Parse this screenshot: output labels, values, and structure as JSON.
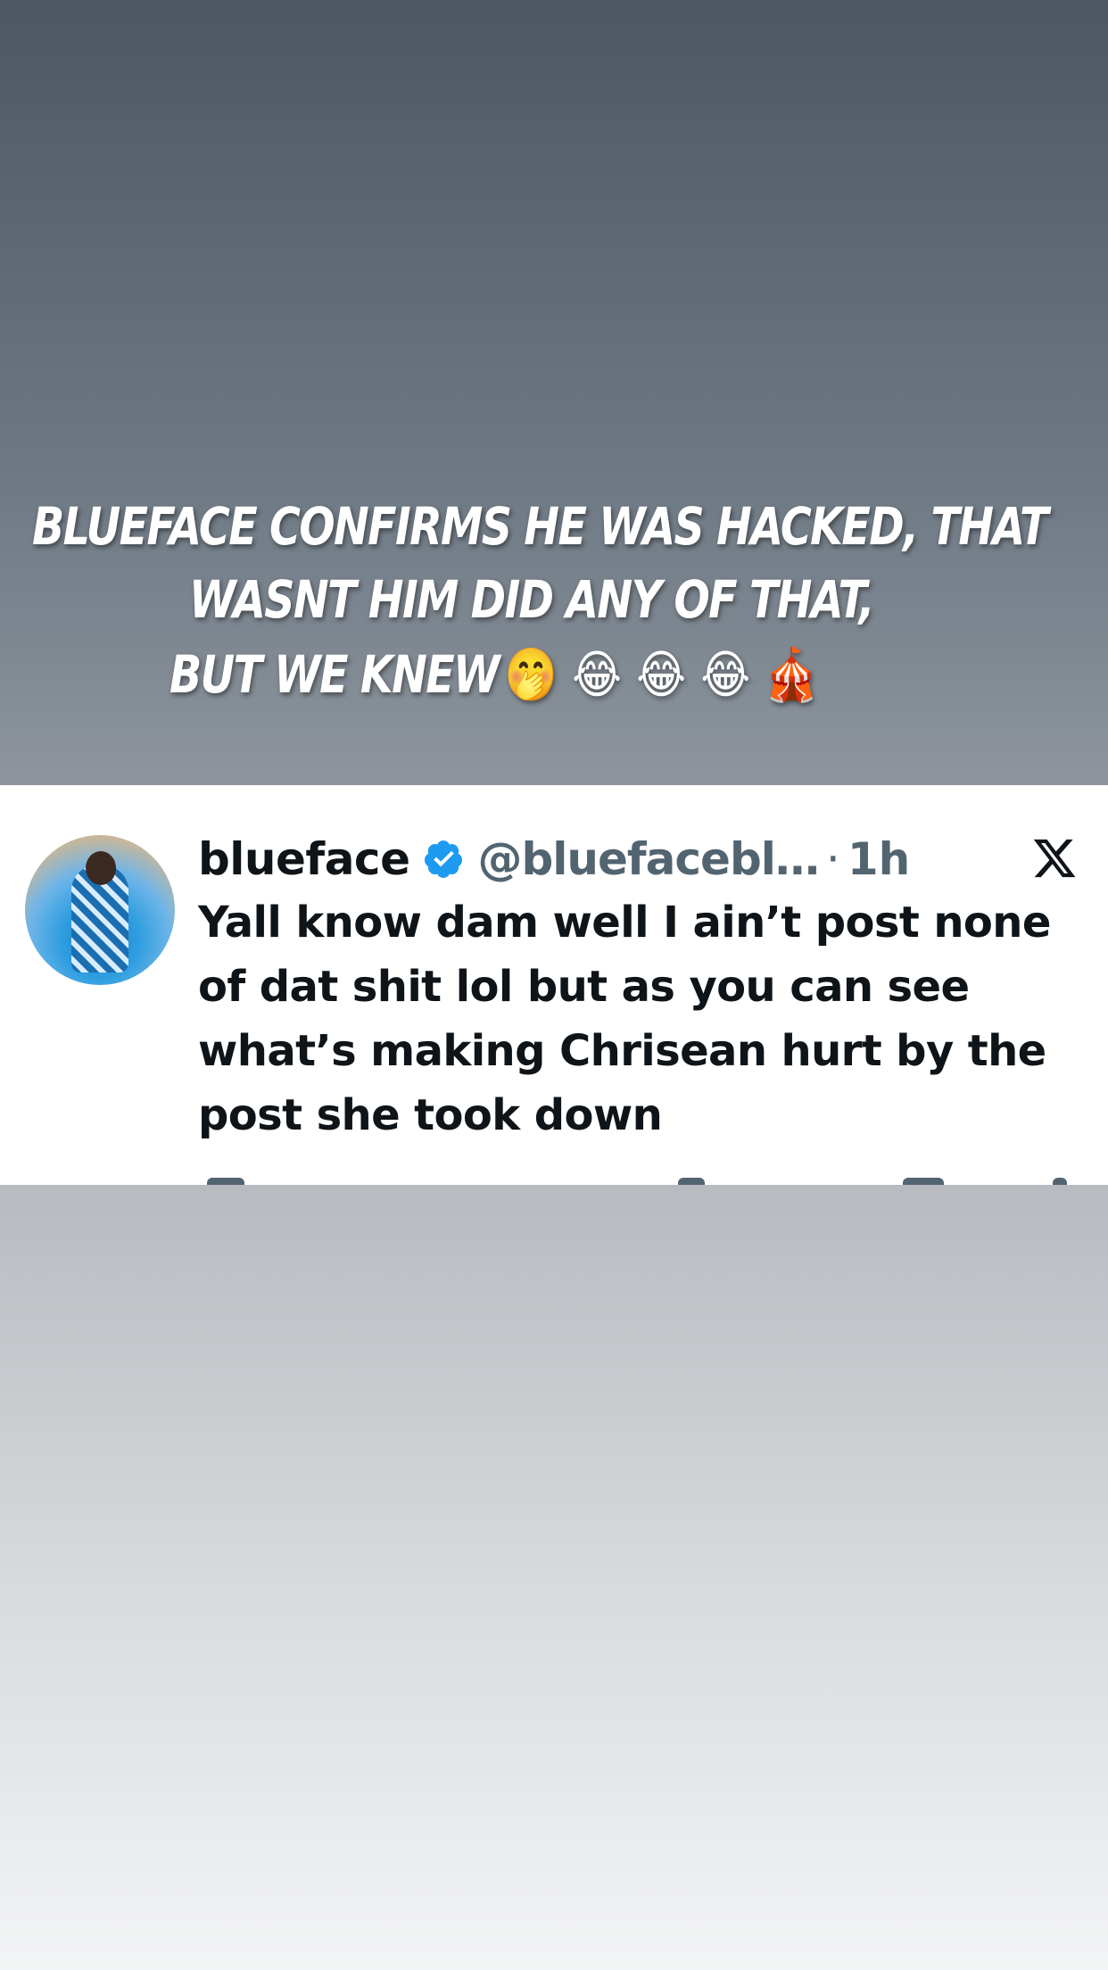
{
  "caption": {
    "line1": "BLUEFACE CONFIRMS HE WAS HACKED, THAT",
    "line2": "WASNT HIM DID ANY OF THAT,",
    "line3": "BUT WE KNEW",
    "emojis": "🤭 😂 😂 😂 🎪"
  },
  "tweet": {
    "name": "blueface",
    "handle": "@bluefacebl…",
    "separator": "·",
    "time": "1h",
    "text": "Yall know dam well I ain’t post none of dat shit lol but as you can see what’s making Chrisean hurt by the post she took down",
    "verified_color": "#1d9bf0"
  },
  "icons": {
    "verified": "verified-badge-icon",
    "platform": "x-logo-icon",
    "avatar": "avatar"
  }
}
